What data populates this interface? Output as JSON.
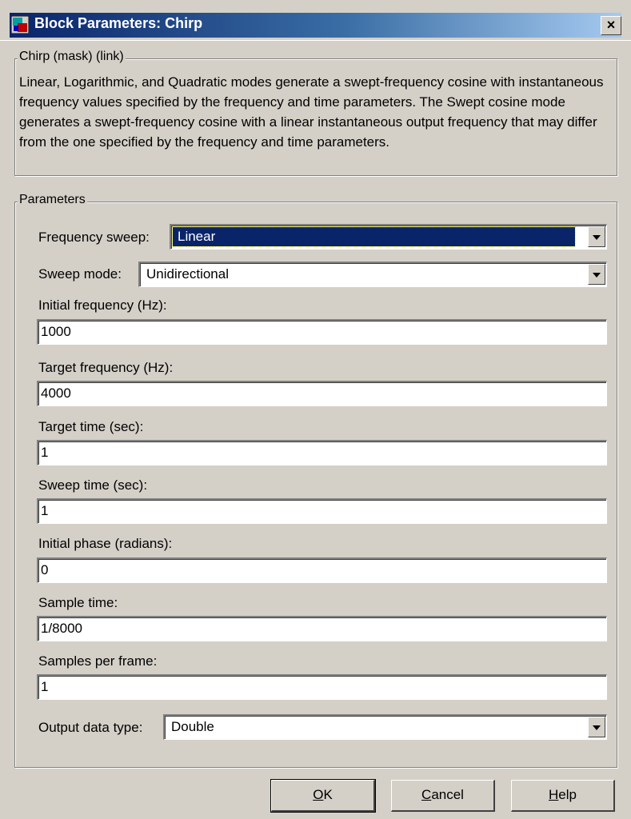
{
  "window": {
    "title": "Block Parameters: Chirp",
    "close_label": "×"
  },
  "mask_group": {
    "legend": "Chirp (mask) (link)",
    "description": "Linear, Logarithmic, and Quadratic modes generate a swept-frequency cosine with instantaneous frequency values specified by the frequency and time parameters. The Swept cosine mode generates a swept-frequency cosine with a linear instantaneous output frequency that may differ from the one specified by the frequency and time parameters."
  },
  "params": {
    "legend": "Parameters",
    "frequency_sweep": {
      "label": "Frequency sweep:",
      "value": "Linear"
    },
    "sweep_mode": {
      "label": "Sweep mode:",
      "value": "Unidirectional"
    },
    "initial_frequency": {
      "label": "Initial frequency (Hz):",
      "value": "1000"
    },
    "target_frequency": {
      "label": "Target frequency (Hz):",
      "value": "4000"
    },
    "target_time": {
      "label": "Target time (sec):",
      "value": "1"
    },
    "sweep_time": {
      "label": "Sweep time (sec):",
      "value": "1"
    },
    "initial_phase": {
      "label": "Initial phase (radians):",
      "value": "0"
    },
    "sample_time": {
      "label": "Sample time:",
      "value": "1/8000"
    },
    "samples_per_frame": {
      "label": "Samples per frame:",
      "value": "1"
    },
    "output_data_type": {
      "label": "Output data type:",
      "value": "Double"
    }
  },
  "buttons": {
    "ok_mnemonic": "O",
    "ok_rest": "K",
    "cancel_mnemonic": "C",
    "cancel_rest": "ancel",
    "help_mnemonic": "H",
    "help_rest": "elp"
  }
}
